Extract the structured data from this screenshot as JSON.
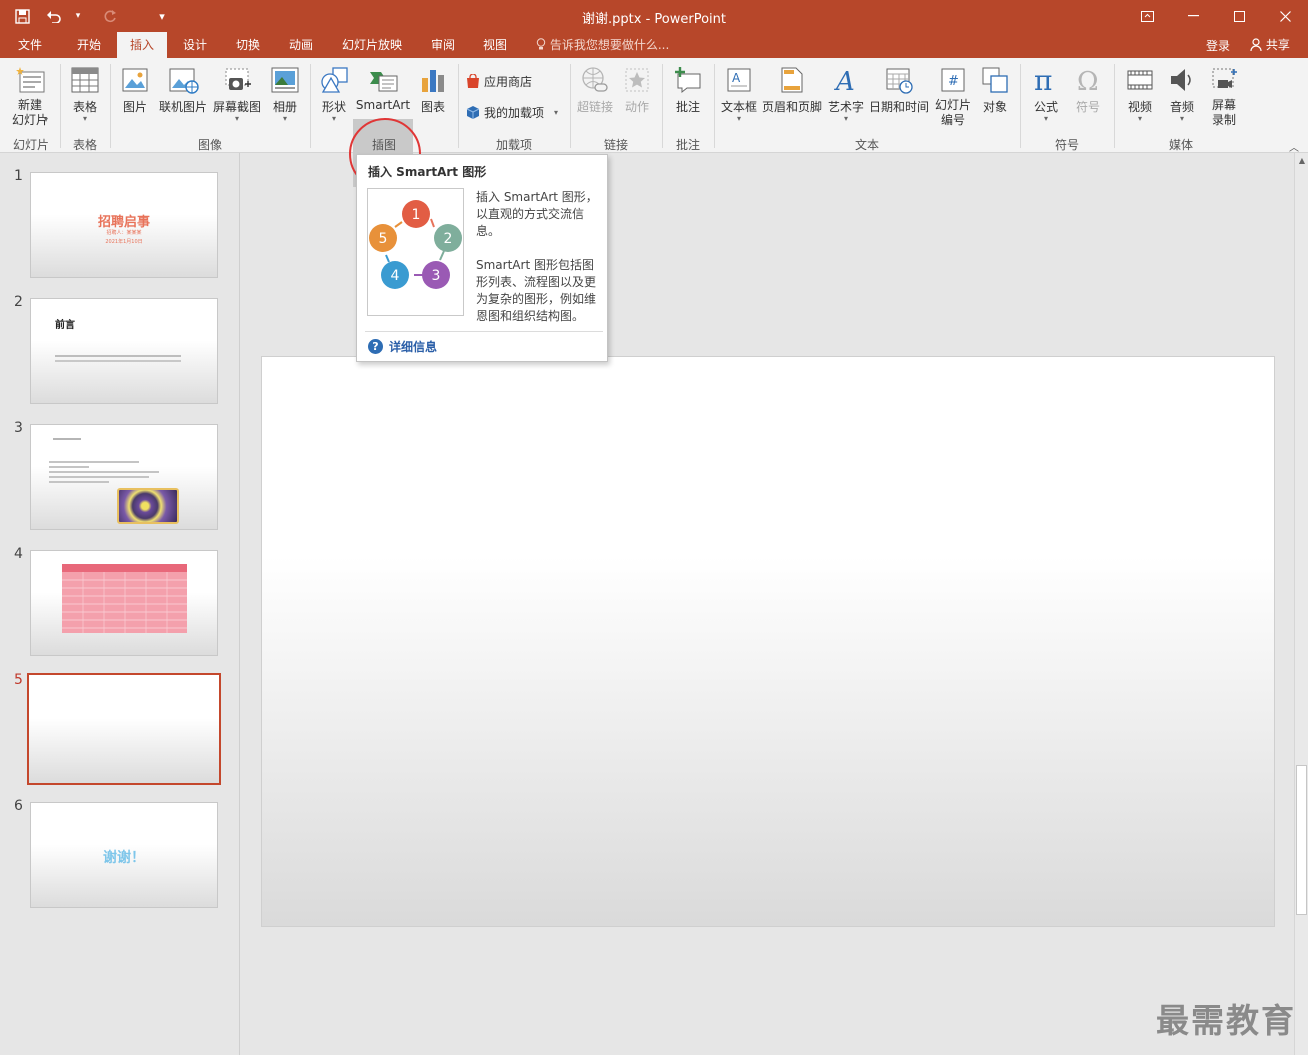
{
  "window": {
    "title": "谢谢.pptx - PowerPoint",
    "qat_customize": "▾"
  },
  "tabs": [
    {
      "label": "文件"
    },
    {
      "label": "开始"
    },
    {
      "label": "插入"
    },
    {
      "label": "设计"
    },
    {
      "label": "切换"
    },
    {
      "label": "动画"
    },
    {
      "label": "幻灯片放映"
    },
    {
      "label": "审阅"
    },
    {
      "label": "视图"
    }
  ],
  "active_tab": "插入",
  "tell_me": "告诉我您想要做什么...",
  "account": {
    "login": "登录",
    "share": "共享"
  },
  "ribbon": {
    "new_slide": "新建\n幻灯片",
    "table": "表格",
    "picture": "图片",
    "online_picture": "联机图片",
    "screenshot": "屏幕截图",
    "album": "相册",
    "shapes": "形状",
    "smartart": "SmartArt",
    "chart": "图表",
    "store": "应用商店",
    "my_addins": "我的加载项",
    "hyperlink": "超链接",
    "action": "动作",
    "comment": "批注",
    "textbox": "文本框",
    "header_footer": "页眉和页脚",
    "wordart": "艺术字",
    "datetime": "日期和时间",
    "slide_number": "幻灯片\n编号",
    "object": "对象",
    "equation": "公式",
    "symbol": "符号",
    "video": "视频",
    "audio": "音频",
    "screen_recording": "屏幕\n录制",
    "groups": {
      "slides": "幻灯片",
      "tables": "表格",
      "images": "图像",
      "illustrations": "插图",
      "addins": "加载项",
      "links": "链接",
      "comments": "批注",
      "text": "文本",
      "symbols": "符号",
      "media": "媒体"
    }
  },
  "tooltip": {
    "title": "插入 SmartArt 图形",
    "desc1": "插入 SmartArt 图形，以直观的方式交流信息。",
    "desc2": "SmartArt 图形包括图形列表、流程图以及更为复杂的图形，例如维恩图和组织结构图。",
    "more_info": "详细信息",
    "diagram_numbers": [
      "1",
      "2",
      "3",
      "4",
      "5"
    ]
  },
  "slides": [
    {
      "num": "1",
      "title": "招聘启事",
      "sub1": "招聘人：某某某",
      "sub2": "2021年1月10日"
    },
    {
      "num": "2",
      "title": "前言"
    },
    {
      "num": "3"
    },
    {
      "num": "4"
    },
    {
      "num": "5"
    },
    {
      "num": "6",
      "title": "谢谢！"
    }
  ],
  "watermark": "最需教育"
}
